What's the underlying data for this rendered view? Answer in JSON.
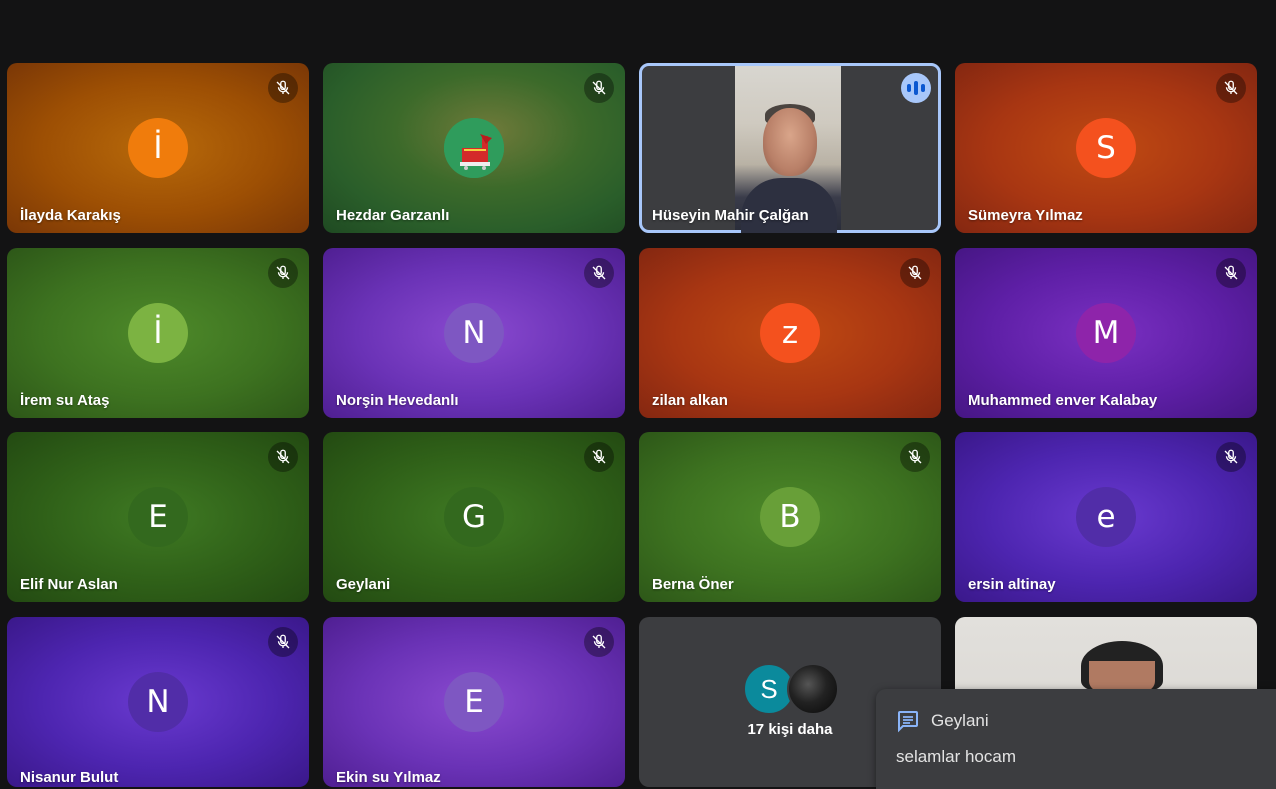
{
  "participants": [
    {
      "name": "İlayda Karakış",
      "initial": "İ",
      "avatar_color": "#f07c0c",
      "muted": true
    },
    {
      "name": "Hezdar Garzanlı",
      "initial": "",
      "avatar_color": "#2f9c5c",
      "muted": true
    },
    {
      "name": "Hüseyin Mahir Çalğan",
      "speaking": true
    },
    {
      "name": "Sümeyra Yılmaz",
      "initial": "S",
      "avatar_color": "#f4511e",
      "muted": true
    },
    {
      "name": "İrem su Ataş",
      "initial": "İ",
      "avatar_color": "#7cb342",
      "muted": true
    },
    {
      "name": "Norşin Hevedanlı",
      "initial": "N",
      "avatar_color": "#7e57c2",
      "muted": true
    },
    {
      "name": "zilan alkan",
      "initial": "z",
      "avatar_color": "#f4511e",
      "muted": true
    },
    {
      "name": "Muhammed enver Kalabay",
      "initial": "M",
      "avatar_color": "#8e24aa",
      "muted": true
    },
    {
      "name": "Elif Nur Aslan",
      "initial": "E",
      "avatar_color": "#33691e",
      "muted": true
    },
    {
      "name": "Geylani",
      "initial": "G",
      "avatar_color": "#33691e",
      "muted": true
    },
    {
      "name": "Berna Öner",
      "initial": "B",
      "avatar_color": "#689f38",
      "muted": true
    },
    {
      "name": "ersin altinay",
      "initial": "e",
      "avatar_color": "#512da8",
      "muted": true
    },
    {
      "name": "Nisanur Bulut",
      "initial": "N",
      "avatar_color": "#512da8",
      "muted": true
    },
    {
      "name": "Ekin su Yılmaz",
      "initial": "E",
      "avatar_color": "#7e57c2",
      "muted": true
    }
  ],
  "overflow": {
    "label": "17 kişi daha",
    "initial": "S"
  },
  "chat_toast": {
    "sender": "Geylani",
    "message": "selamlar hocam"
  },
  "icons": {
    "muted": "mic-off-icon",
    "speaking": "audio-bars-icon",
    "chat": "chat-icon"
  }
}
